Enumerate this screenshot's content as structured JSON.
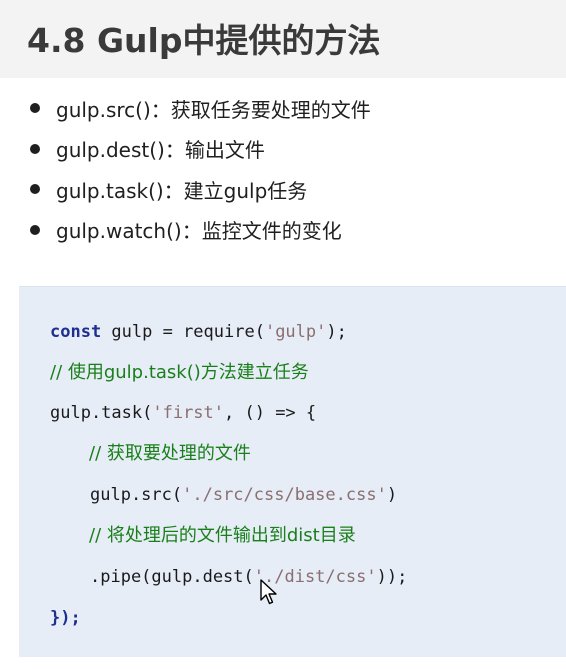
{
  "slide": {
    "title": "4.8 Gulp中提供的方法",
    "bullets": [
      "gulp.src()：获取任务要处理的文件",
      "gulp.dest()：输出文件",
      "gulp.task()：建立gulp任务",
      "gulp.watch()：监控文件的变化"
    ]
  },
  "code": {
    "line1": {
      "keyword": "const",
      "rest": " gulp = require(",
      "string": "'gulp'",
      "end": ");"
    },
    "line2": {
      "comment": "// 使用gulp.task()方法建立任务"
    },
    "line3": {
      "pre": "gulp.task(",
      "string": "'first'",
      "post": ", () => {"
    },
    "line4": {
      "comment": "// 获取要处理的文件"
    },
    "line5": {
      "pre": "gulp.src(",
      "string": "'./src/css/base.css'",
      "post": ")"
    },
    "line6": {
      "comment": "// 将处理后的文件输出到dist目录"
    },
    "line7": {
      "pre": ".pipe(gulp.dest(",
      "string": "'./dist/css'",
      "post": "));"
    },
    "line8": {
      "text": "});"
    }
  },
  "colors": {
    "code_background": "#e6edf7",
    "keyword": "#1f2f8f",
    "string": "#8a6f6f",
    "comment": "#1a7f1a",
    "title": "#3a3a3a"
  },
  "icons": {
    "cursor": "mouse-pointer-icon"
  }
}
